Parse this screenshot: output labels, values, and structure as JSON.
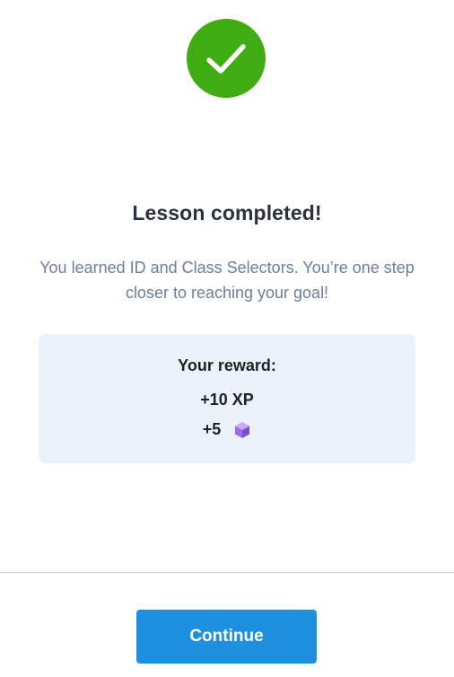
{
  "status": {
    "icon": "checkmark-icon",
    "color": "#3fad12"
  },
  "lesson": {
    "title": "Lesson completed!",
    "message": "You learned ID and Class Selectors. You’re one step closer to reaching your goal!"
  },
  "reward": {
    "title": "Your reward:",
    "xp": "+10 XP",
    "gems": "+5",
    "gem_icon": "gem-cube-icon",
    "background": "#ecf2fb"
  },
  "actions": {
    "continue_label": "Continue",
    "continue_color": "#1f8fe0"
  }
}
